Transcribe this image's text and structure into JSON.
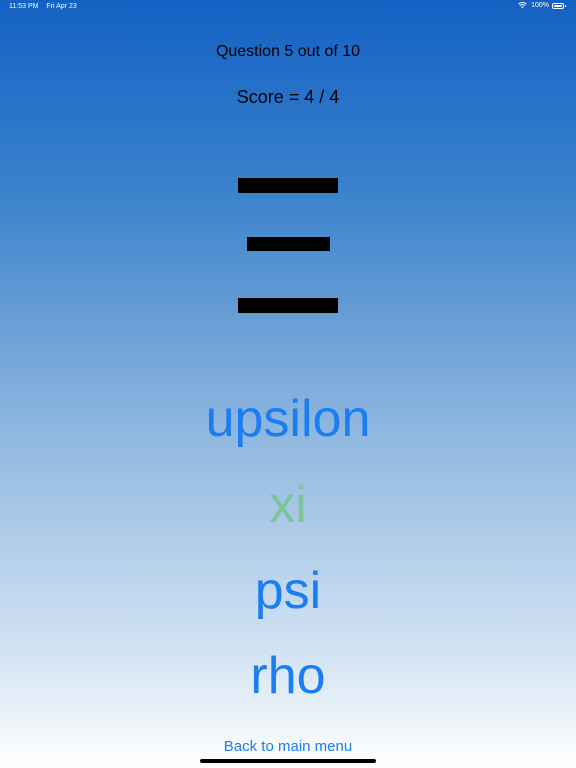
{
  "status_bar": {
    "time": "11:53 PM",
    "date": "Fri Apr 23",
    "battery": "100%",
    "wifi_icon": "wifi-icon",
    "battery_icon": "battery-icon"
  },
  "quiz": {
    "question_progress": "Question 5 out of 10",
    "score": "Score = 4 / 4",
    "glyph_icon": "greek-xi-glyph",
    "choices": [
      {
        "label": "upsilon",
        "state": "default"
      },
      {
        "label": "xi",
        "state": "correct"
      },
      {
        "label": "psi",
        "state": "default"
      },
      {
        "label": "rho",
        "state": "default"
      }
    ]
  },
  "navigation": {
    "back_label": "Back to main menu"
  },
  "colors": {
    "accent": "#1a7ef2",
    "correct": "#7cc49a",
    "gradient_top": "#1461c4",
    "gradient_bottom": "#ffffff"
  }
}
